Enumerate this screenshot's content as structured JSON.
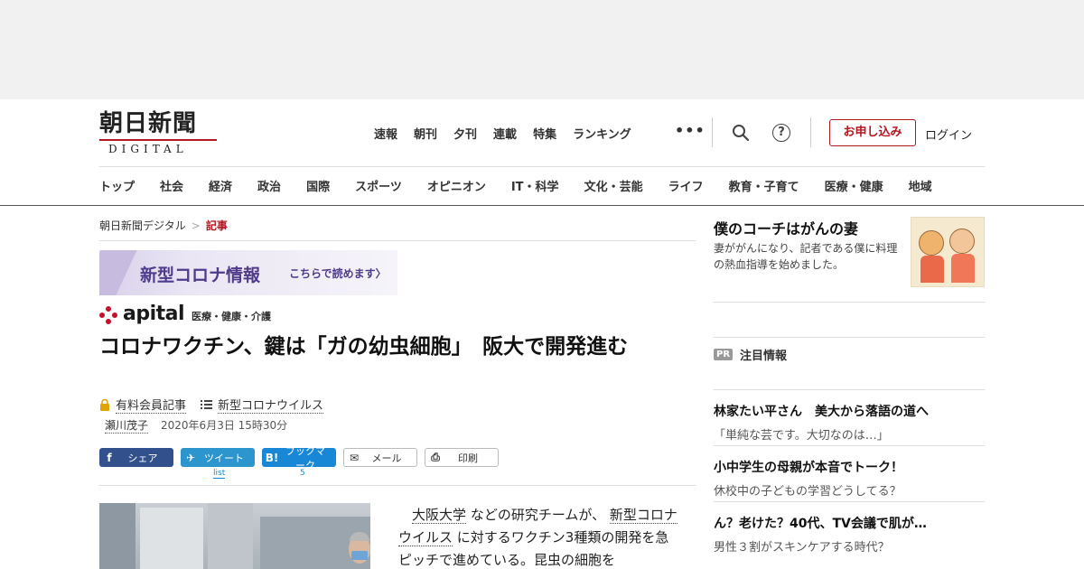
{
  "header": {
    "logo_jp": "朝日新聞",
    "logo_en": "DIGITAL",
    "nav": [
      "速報",
      "朝刊",
      "夕刊",
      "連載",
      "特集",
      "ランキング"
    ],
    "more": "•••",
    "subscribe": "お申し込み",
    "login": "ログイン",
    "help_symbol": "?"
  },
  "categories": [
    "トップ",
    "社会",
    "経済",
    "政治",
    "国際",
    "スポーツ",
    "オピニオン",
    "IT・科学",
    "文化・芸能",
    "ライフ",
    "教育・子育て",
    "医療・健康",
    "地域"
  ],
  "breadcrumb": {
    "home": "朝日新聞デジタル",
    "sep": ">",
    "current": "記事"
  },
  "covid_banner": {
    "main": "新型コロナ情報",
    "sub": "こちらで読めます〉"
  },
  "apital": {
    "brand": "apital",
    "category": "医療・健康・介護"
  },
  "article": {
    "title": "コロナワクチン、鍵は「ガの幼虫細胞」　阪大で開発進む",
    "paid": "有料会員記事",
    "tag": "新型コロナウイルス",
    "author": "瀬川茂子",
    "date": "2020年6月3日 15時30分",
    "body": {
      "p1": "大阪大学",
      "p2": "などの研究チームが、",
      "p3": "新型コロナウイルス",
      "p4": "に対するワクチン3種類の開発を急ピッチで進めている。昆虫の細胞を"
    }
  },
  "share": {
    "fb": "シェア",
    "fb_icon": "f",
    "tw": "ツイート",
    "tw_icon": "✈",
    "hb": "ブックマーク",
    "hb_icon": "B!",
    "mail": "メール",
    "mail_icon": "✉",
    "print": "印刷",
    "print_icon": "⎙",
    "tw_count": "list",
    "hb_count": "5"
  },
  "sidebar": {
    "promo": {
      "title": "僕のコーチはがんの妻",
      "desc": "妻ががんになり、記者である僕に料理の熱血指導を始めました。"
    },
    "pr": {
      "badge": "PR",
      "label": "注目情報"
    },
    "items": [
      {
        "title": "林家たい平さん　美大から落語の道へ",
        "sub": "「単純な芸です。大切なのは…」"
      },
      {
        "title": "小中学生の母親が本音でトーク！",
        "sub": "休校中の子どもの学習どうしてる？"
      },
      {
        "title": "ん？老けた？40代、TV会議で肌が…",
        "sub": "男性３割がスキンケアする時代？"
      }
    ]
  },
  "colors": {
    "brand_red": "#b4151f",
    "covid_purple": "#4e3b8c",
    "fb": "#31508c",
    "tw": "#2d95cd",
    "hb": "#1888d6"
  }
}
